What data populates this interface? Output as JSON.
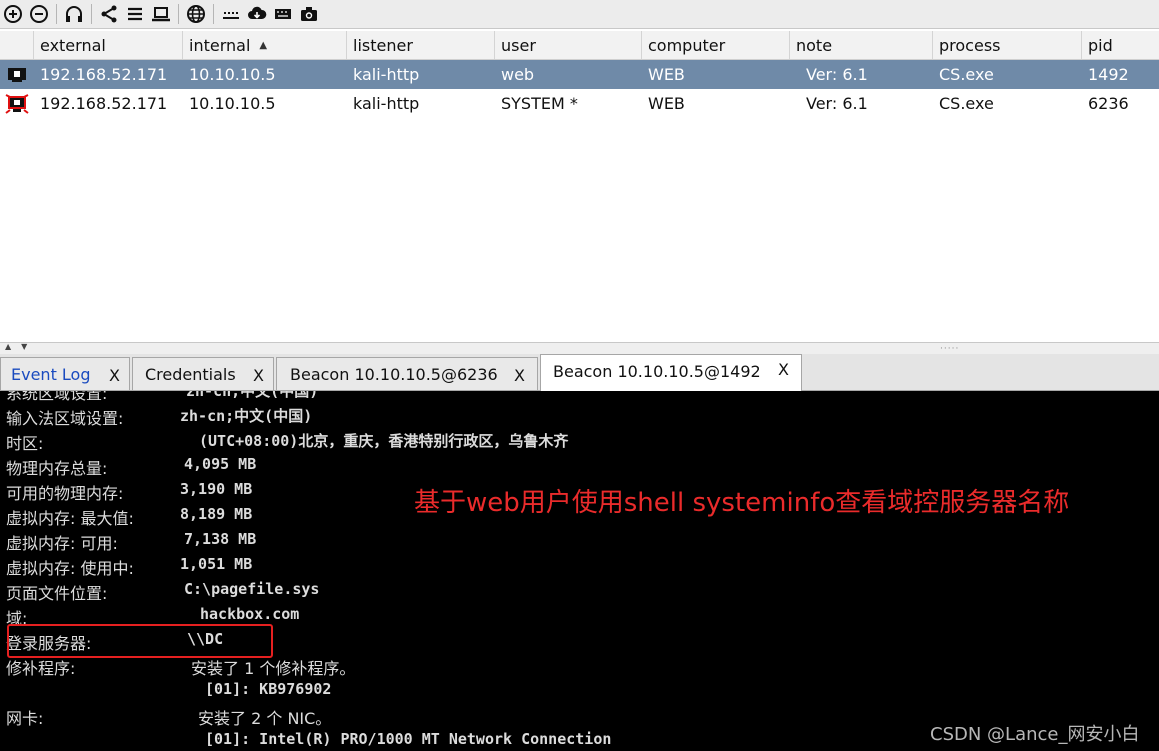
{
  "toolbar": {
    "icons": [
      "connect-icon",
      "disconnect-icon",
      "headphones-icon",
      "share-icon",
      "list-icon",
      "laptop-icon",
      "globe-icon",
      "keyboard-dots-icon",
      "cloud-download-icon",
      "keyboard-icon",
      "camera-icon"
    ]
  },
  "table": {
    "columns": [
      "external",
      "internal",
      "listener",
      "user",
      "computer",
      "note",
      "process",
      "pid"
    ],
    "sort_indicator": "▲",
    "rows": [
      {
        "external": "192.168.52.171",
        "internal": "10.10.10.5",
        "listener": "kali-http",
        "user": "web",
        "computer": "WEB",
        "note": "Ver: 6.1",
        "process": "CS.exe",
        "pid": "1492",
        "selected": true
      },
      {
        "external": "192.168.52.171",
        "internal": "10.10.10.5",
        "listener": "kali-http",
        "user": "SYSTEM *",
        "computer": "WEB",
        "note": "Ver: 6.1",
        "process": "CS.exe",
        "pid": "6236",
        "selected": false
      }
    ]
  },
  "tabs": [
    {
      "label": "Event Log",
      "close": "X",
      "color": "#1a4bbf"
    },
    {
      "label": "Credentials",
      "close": "X"
    },
    {
      "label": "Beacon 10.10.10.5@6236",
      "close": "X"
    },
    {
      "label": "Beacon 10.10.10.5@1492",
      "close": "X",
      "active": true
    }
  ],
  "console": {
    "lines": [
      {
        "label": "系统区域设置:",
        "value": "zh-cn;中文(中国)"
      },
      {
        "label": "输入法区域设置:",
        "value": "zh-cn;中文(中国)"
      },
      {
        "label": "时区:",
        "value": "(UTC+08:00)北京，重庆，香港特别行政区，乌鲁木齐"
      },
      {
        "label": "物理内存总量:",
        "value": "4,095 MB"
      },
      {
        "label": "可用的物理内存:",
        "value": "3,190 MB"
      },
      {
        "label": "虚拟内存: 最大值:",
        "value": "8,189 MB"
      },
      {
        "label": "虚拟内存: 可用:",
        "value": "7,138 MB"
      },
      {
        "label": "虚拟内存: 使用中:",
        "value": "1,051 MB"
      },
      {
        "label": "页面文件位置:",
        "value": "C:\\pagefile.sys"
      },
      {
        "label": "域:",
        "value": "hackbox.com"
      },
      {
        "label": "登录服务器:",
        "value": "\\\\DC"
      },
      {
        "label": "修补程序:",
        "value": "安装了 1 个修补程序。"
      },
      {
        "label": "",
        "value": "[01]: KB976902"
      },
      {
        "label": "网卡:",
        "value": "安装了 2 个 NIC。"
      },
      {
        "label": "",
        "value": "[01]: Intel(R) PRO/1000 MT Network Connection"
      }
    ]
  },
  "annotation": "基于web用户使用shell systeminfo查看域控服务器名称",
  "watermark": "CSDN @Lance_网安小白",
  "colors": {
    "selected_row": "#6f8aa8",
    "annotation": "#ea2b2b",
    "console_bg": "#000000"
  }
}
